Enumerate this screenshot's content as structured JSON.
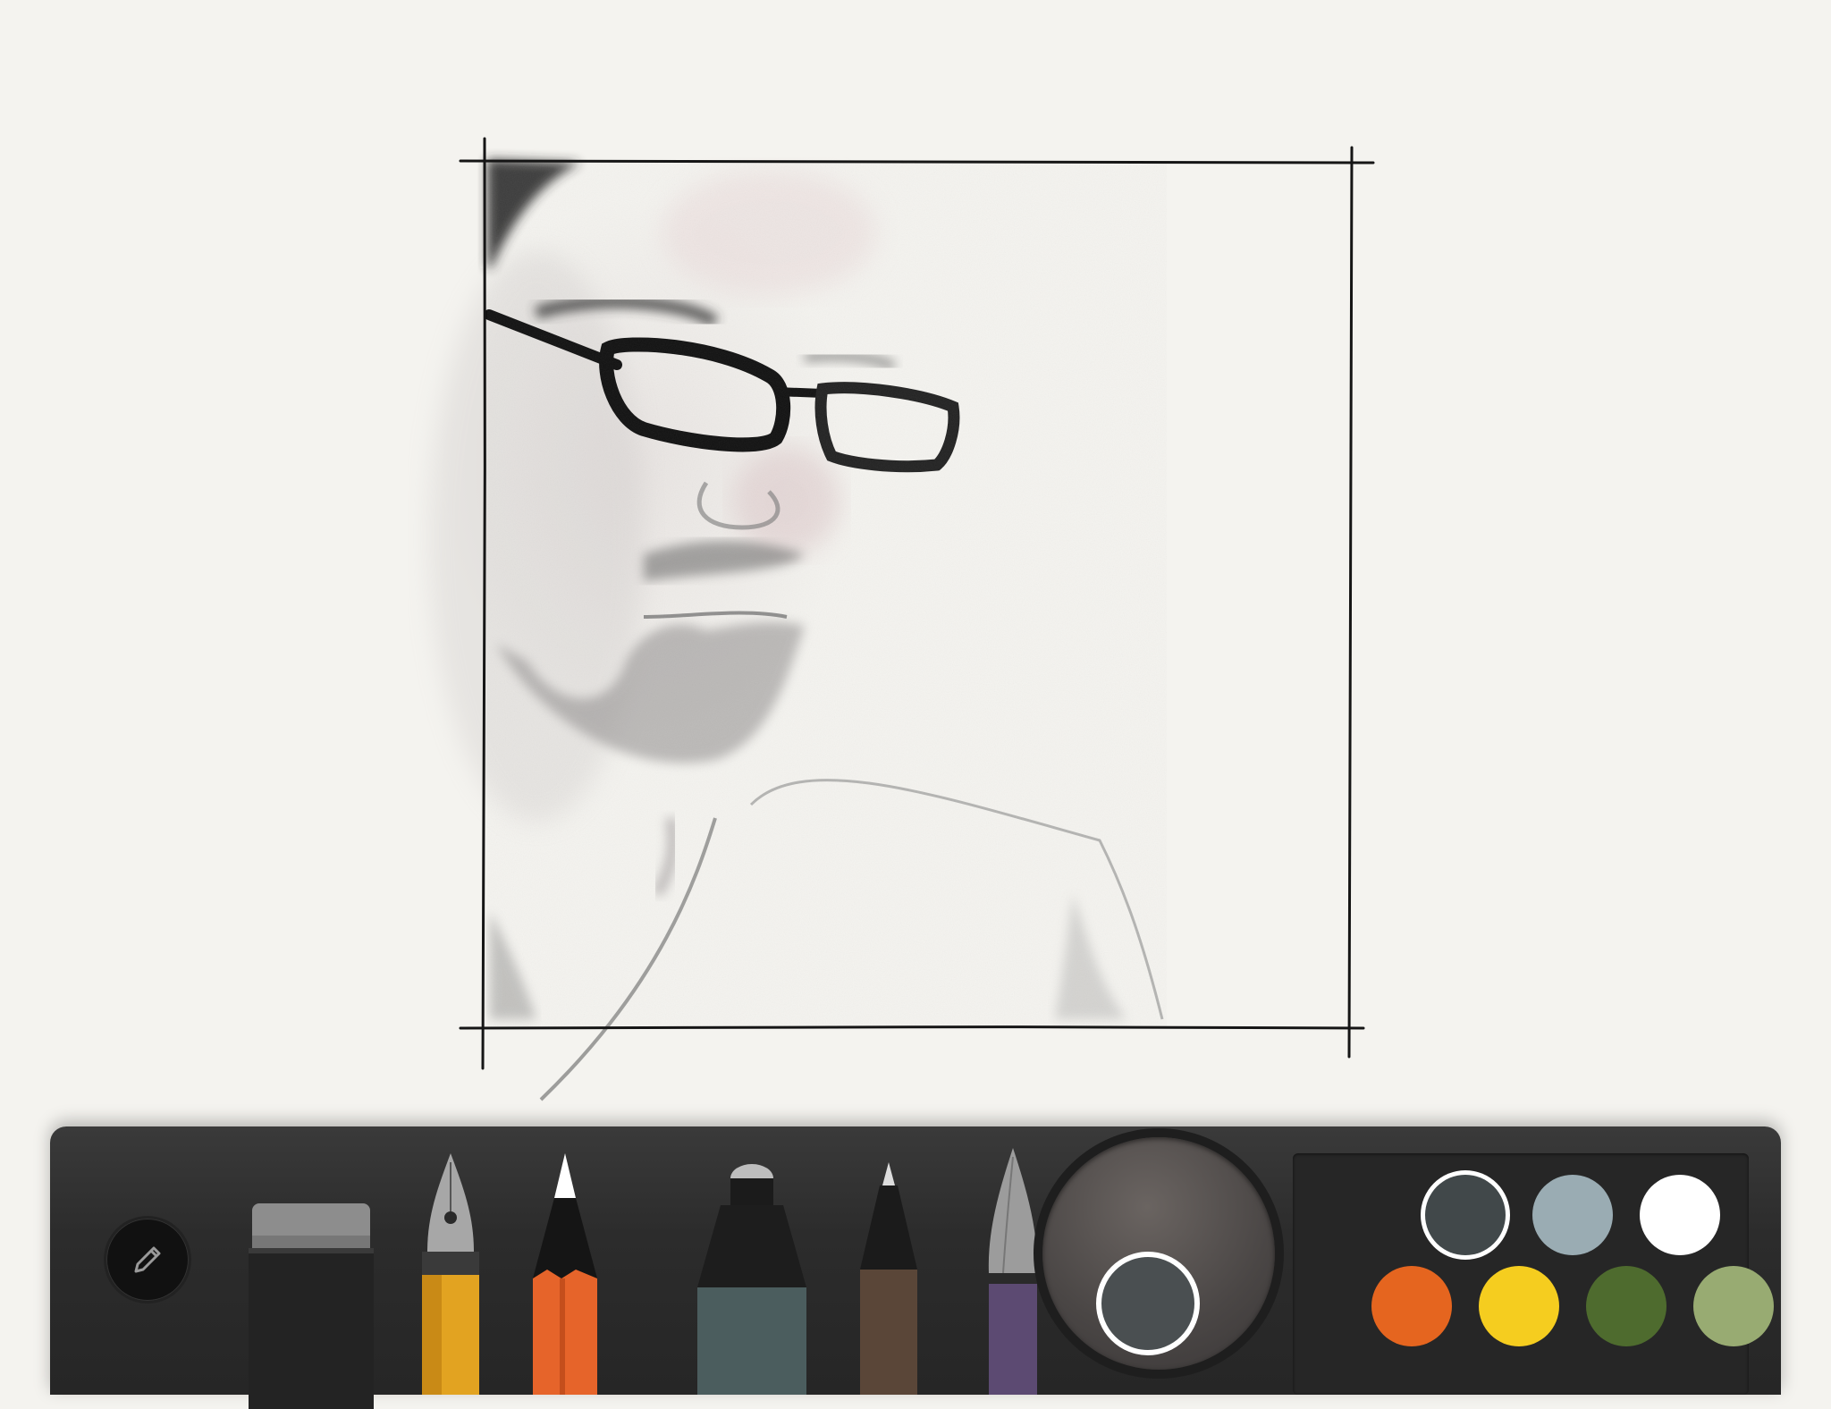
{
  "app": {
    "icons": {
      "pencil_toggle": "pencil-icon"
    }
  },
  "tools": [
    {
      "name": "eraser",
      "icon": "eraser-icon",
      "color": "#2b2b2b"
    },
    {
      "name": "fountain-pen",
      "icon": "fountain-pen-icon",
      "color": "#e2a321"
    },
    {
      "name": "pencil",
      "icon": "pencil-tool-icon",
      "color": "#e6642a"
    },
    {
      "name": "marker",
      "icon": "marker-icon",
      "color": "#4b5d5e"
    },
    {
      "name": "fine-pen",
      "icon": "fine-pen-icon",
      "color": "#5a4638"
    },
    {
      "name": "brush",
      "icon": "brush-icon",
      "color": "#5c4a72"
    }
  ],
  "current_color": "#4a4f51",
  "palette": [
    {
      "color": "#41484a",
      "selected": true
    },
    {
      "color": "#9aacb3",
      "selected": false
    },
    {
      "color": "#ffffff",
      "selected": false
    },
    {
      "color": "#e5651f",
      "selected": false
    },
    {
      "color": "#f5cd1f",
      "selected": false
    },
    {
      "color": "#4e6b2e",
      "selected": false
    },
    {
      "color": "#98ab72",
      "selected": false
    }
  ]
}
